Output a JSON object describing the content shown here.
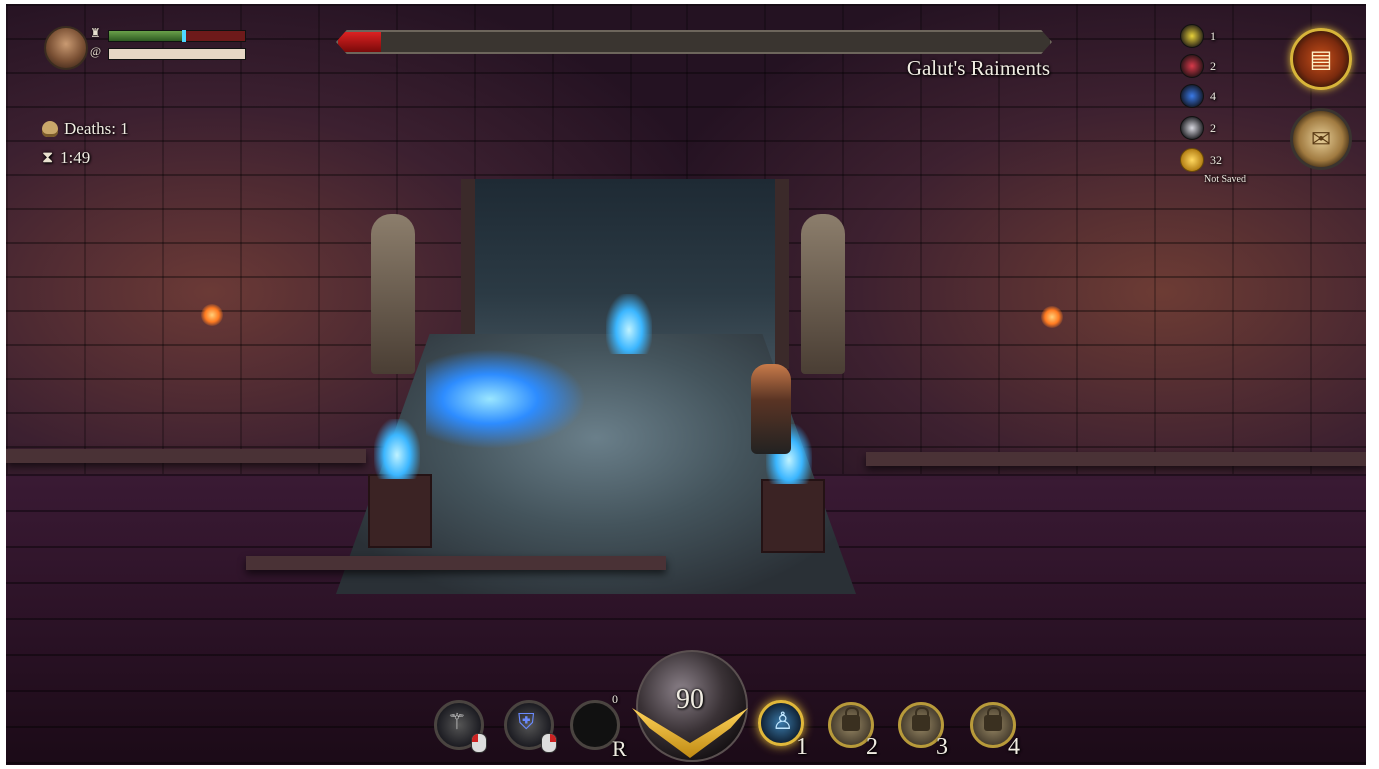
{
  "player": {
    "health_fraction": 0.55,
    "mana_fraction": 1.0
  },
  "boss": {
    "name": "Galut's Raiments",
    "health_fraction": 0.06
  },
  "stats": {
    "deaths": "Deaths: 1",
    "timer": "1:49"
  },
  "resources": [
    {
      "icon": "yellow-gem-icon",
      "color": "#e8d23a",
      "count": "1"
    },
    {
      "icon": "red-gem-icon",
      "color": "#d83a4a",
      "count": "2"
    },
    {
      "icon": "blue-gem-icon",
      "color": "#3a7ae8",
      "count": "4"
    },
    {
      "icon": "white-gem-icon",
      "color": "#d8d8e0",
      "count": "2"
    },
    {
      "icon": "gold-coins-icon",
      "color": "#f0b820",
      "count": "32"
    }
  ],
  "save_status": "Not Saved",
  "skills": {
    "orb_value": "90",
    "swap_key": "R",
    "swap_count": "0",
    "slots": [
      {
        "label": "1",
        "state": "active"
      },
      {
        "label": "2",
        "state": "locked"
      },
      {
        "label": "3",
        "state": "locked"
      },
      {
        "label": "4",
        "state": "locked"
      }
    ]
  }
}
